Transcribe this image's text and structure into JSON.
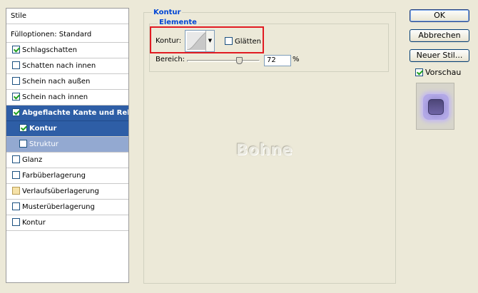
{
  "styles_panel": {
    "header": "Stile",
    "items": [
      {
        "label": "Fülloptionen: Standard",
        "checkbox": false
      },
      {
        "label": "Schlagschatten",
        "checkbox": true,
        "checked": true
      },
      {
        "label": "Schatten nach innen",
        "checkbox": true,
        "checked": false
      },
      {
        "label": "Schein nach außen",
        "checkbox": true,
        "checked": false
      },
      {
        "label": "Schein nach innen",
        "checkbox": true,
        "checked": true
      },
      {
        "label": "Abgeflachte Kante und Relief",
        "checkbox": true,
        "checked": true,
        "selected": true
      },
      {
        "label": "Kontur",
        "checkbox": true,
        "checked": true,
        "selected": true,
        "child": true
      },
      {
        "label": "Struktur",
        "checkbox": true,
        "checked": false,
        "child": true
      },
      {
        "label": "Glanz",
        "checkbox": true,
        "checked": false
      },
      {
        "label": "Farbüberlagerung",
        "checkbox": true,
        "checked": false
      },
      {
        "label": "Verlaufsüberlagerung",
        "checkbox": true,
        "checked": false
      },
      {
        "label": "Musterüberlagerung",
        "checkbox": true,
        "checked": false
      },
      {
        "label": "Kontur",
        "checkbox": true,
        "checked": false
      }
    ]
  },
  "main": {
    "group_title": "Kontur",
    "sub_title": "Elemente",
    "contour_label": "Kontur:",
    "smooth_label": "Glätten",
    "smooth_checked": false,
    "range_label": "Bereich:",
    "range_value": "72",
    "range_unit": "%",
    "range_fraction": 0.72,
    "preview_text": "Bohne"
  },
  "buttons": {
    "ok": "OK",
    "cancel": "Abbrechen",
    "new_style": "Neuer Stil...",
    "preview_label": "Vorschau",
    "preview_checked": true
  },
  "colors": {
    "selection": "#2e5ea6",
    "highlight_border": "#e11b22",
    "group_title": "#0046d5"
  },
  "icons": {
    "contour_dropdown": "chevron-down-icon",
    "preview_swatch": "style-preview-icon"
  }
}
